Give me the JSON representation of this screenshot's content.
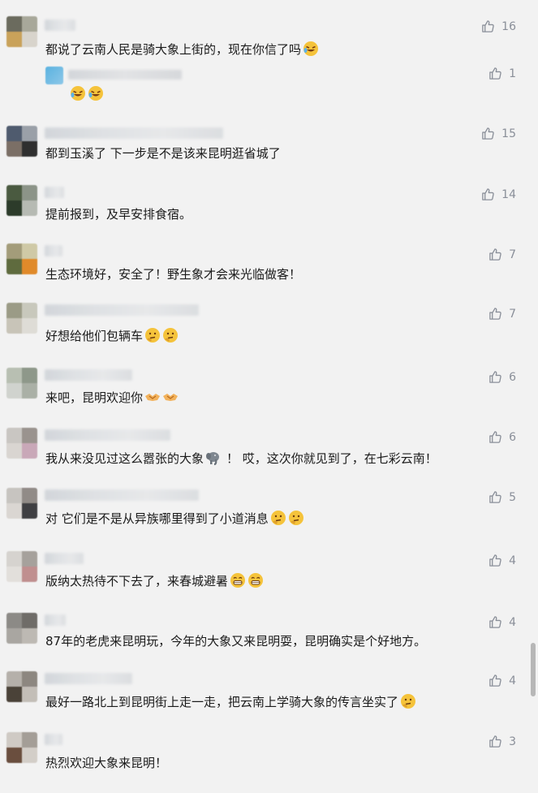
{
  "comments": [
    {
      "text": "都说了云南人民是骑大象上街的，现在你信了吗",
      "likes": "16",
      "emojis": [
        "laugh-cry-emoji"
      ]
    },
    {
      "text": "都到玉溪了  下一步是不是该来昆明逛省城了",
      "likes": "15",
      "emojis": []
    },
    {
      "text": "提前报到，及早安排食宿。",
      "likes": "14",
      "emojis": []
    },
    {
      "text": "生态环境好，安全了！野生象才会来光临做客！",
      "likes": "7",
      "emojis": []
    },
    {
      "text": "好想给他们包辆车",
      "likes": "7",
      "emojis": [
        "thinking-emoji",
        "thinking-emoji"
      ]
    },
    {
      "text": "来吧，昆明欢迎你",
      "likes": "6",
      "emojis": [
        "handshake-emoji",
        "handshake-emoji"
      ]
    },
    {
      "text": "我从来没见过这么嚣张的大象",
      "text2": "！ 哎，这次你就见到了，在七彩云南！",
      "likes": "6",
      "emojis": [
        "elephant-emoji"
      ]
    },
    {
      "text": "对 它们是不是从异族哪里得到了小道消息",
      "likes": "5",
      "emojis": [
        "thinking-emoji",
        "thinking-emoji"
      ]
    },
    {
      "text": "版纳太热待不下去了，来春城避暑",
      "likes": "4",
      "emojis": [
        "grin-emoji",
        "grin-emoji"
      ]
    },
    {
      "text": "87年的老虎来昆明玩，今年的大象又来昆明耍，昆明确实是个好地方。",
      "likes": "4",
      "emojis": []
    },
    {
      "text": "最好一路北上到昆明街上走一走，把云南上学骑大象的传言坐实了",
      "likes": "4",
      "emojis": [
        "thinking-emoji"
      ]
    },
    {
      "text": "热烈欢迎大象来昆明！",
      "likes": "3",
      "emojis": []
    }
  ],
  "reply": {
    "likes": "1",
    "emojis": [
      "laugh-cry-emoji",
      "laugh-cry-emoji"
    ]
  },
  "icons": {
    "like": "thumbs-up-icon"
  },
  "colors": {
    "background": "#f2f2f2",
    "text": "#1a1a1a",
    "like": "#8a8f99",
    "emoji": "#f5c33b"
  }
}
